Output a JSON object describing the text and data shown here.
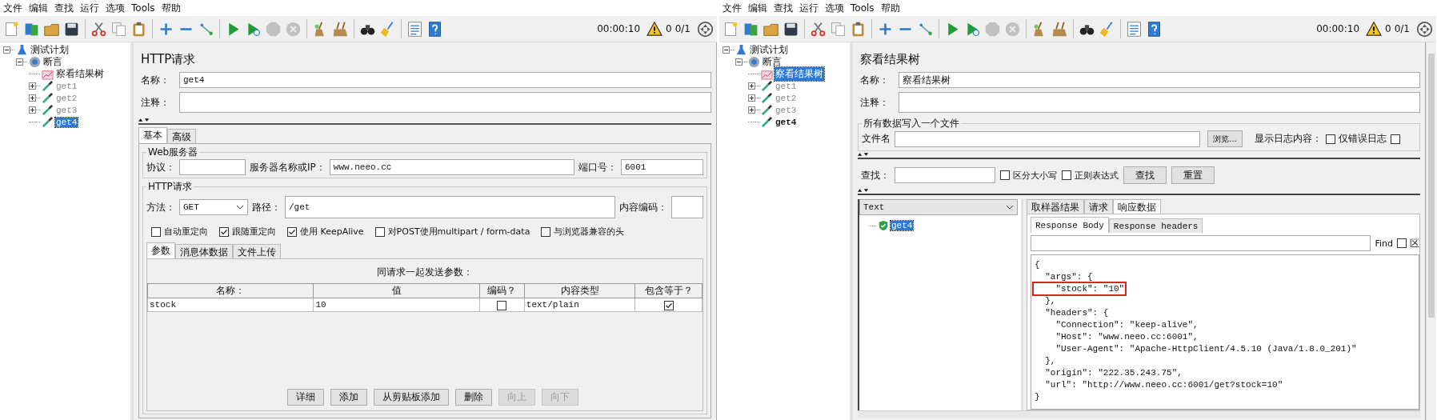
{
  "windows": [
    {
      "kind": "http_request",
      "menu": [
        "文件",
        "编辑",
        "查找",
        "运行",
        "选项",
        "Tools",
        "帮助"
      ],
      "toolbar": [
        {
          "kind": "new",
          "disabled": false
        },
        {
          "kind": "templates",
          "disabled": false
        },
        {
          "kind": "open",
          "disabled": false
        },
        {
          "kind": "save",
          "disabled": false
        },
        {
          "kind": "separator"
        },
        {
          "kind": "cut",
          "disabled": false
        },
        {
          "kind": "copy",
          "disabled": false
        },
        {
          "kind": "paste",
          "disabled": false
        },
        {
          "kind": "separator"
        },
        {
          "kind": "expand",
          "disabled": false
        },
        {
          "kind": "collapse",
          "disabled": false
        },
        {
          "kind": "toggle",
          "disabled": false
        },
        {
          "kind": "separator"
        },
        {
          "kind": "start",
          "disabled": false
        },
        {
          "kind": "start_no_pause",
          "disabled": false
        },
        {
          "kind": "stop",
          "disabled": true
        },
        {
          "kind": "shutdown",
          "disabled": true
        },
        {
          "kind": "separator"
        },
        {
          "kind": "clear",
          "disabled": false
        },
        {
          "kind": "clear_all",
          "disabled": false
        },
        {
          "kind": "separator"
        },
        {
          "kind": "search",
          "disabled": false
        },
        {
          "kind": "reset",
          "disabled": false
        },
        {
          "kind": "separator"
        },
        {
          "kind": "function_helper",
          "disabled": false
        },
        {
          "kind": "help",
          "disabled": false
        }
      ],
      "status": {
        "timer": "00:00:10",
        "warnings": "0",
        "threads": "0/1"
      },
      "tree": [
        {
          "label": "测试计划",
          "kind": "test_plan",
          "expanded": true,
          "selected": false,
          "children": [
            {
              "label": "断言",
              "kind": "assertion",
              "expanded": true,
              "selected": false,
              "children": [
                {
                  "label": "察看结果树",
                  "kind": "listener",
                  "selected": false,
                  "disabled": false,
                  "bold": false
                },
                {
                  "label": "get1",
                  "kind": "sampler",
                  "expanded": false,
                  "selected": false,
                  "disabled": true,
                  "bold": false
                },
                {
                  "label": "get2",
                  "kind": "sampler",
                  "expanded": false,
                  "selected": false,
                  "disabled": true,
                  "bold": false
                },
                {
                  "label": "get3",
                  "kind": "sampler",
                  "expanded": false,
                  "selected": false,
                  "disabled": true,
                  "bold": false
                },
                {
                  "label": "get4",
                  "kind": "sampler",
                  "selected": true,
                  "disabled": false,
                  "bold": false
                }
              ]
            }
          ]
        }
      ],
      "panel": {
        "title": "HTTP请求",
        "name_label": "名称：",
        "name_value": "get4",
        "comment_label": "注释：",
        "tabs": [
          {
            "label": "基本",
            "selected": true
          },
          {
            "label": "高级",
            "selected": false
          }
        ],
        "web_server": {
          "legend": "Web服务器",
          "protocol_label": "协议：",
          "server_label": "服务器名称或IP：",
          "server_value": "www.neeo.cc",
          "port_label": "端口号：",
          "port_value": "6001"
        },
        "http": {
          "legend": "HTTP请求",
          "method_label": "方法：",
          "method_value": "GET",
          "path_label": "路径：",
          "path_value": "/get",
          "encoding_label": "内容编码："
        },
        "options": [
          {
            "label": "自动重定向",
            "checked": false
          },
          {
            "label": "跟随重定向",
            "checked": true
          },
          {
            "label": "使用 KeepAlive",
            "checked": true
          },
          {
            "label": "对POST使用multipart / form-data",
            "checked": false
          },
          {
            "label": "与浏览器兼容的头",
            "checked": false
          }
        ],
        "sub_tabs": [
          {
            "label": "参数",
            "selected": true
          },
          {
            "label": "消息体数据",
            "selected": false
          },
          {
            "label": "文件上传",
            "selected": false
          }
        ],
        "params_caption": "同请求一起发送参数：",
        "columns": [
          "名称：",
          "值",
          "编码？",
          "内容类型",
          "包含等于？"
        ],
        "rows": [
          {
            "name": "stock",
            "value": "10",
            "encode": false,
            "content_type": "text/plain",
            "include_equals": true
          }
        ],
        "buttons": [
          {
            "label": "详细",
            "disabled": false
          },
          {
            "label": "添加",
            "disabled": false
          },
          {
            "label": "从剪贴板添加",
            "disabled": false
          },
          {
            "label": "删除",
            "disabled": false
          },
          {
            "label": "向上",
            "disabled": true
          },
          {
            "label": "向下",
            "disabled": true
          }
        ]
      }
    },
    {
      "kind": "results_tree",
      "menu": [
        "文件",
        "编辑",
        "查找",
        "运行",
        "选项",
        "Tools",
        "帮助"
      ],
      "toolbar": [
        {
          "kind": "new",
          "disabled": false
        },
        {
          "kind": "templates",
          "disabled": false
        },
        {
          "kind": "open",
          "disabled": false
        },
        {
          "kind": "save",
          "disabled": false
        },
        {
          "kind": "separator"
        },
        {
          "kind": "cut",
          "disabled": false
        },
        {
          "kind": "copy",
          "disabled": false
        },
        {
          "kind": "paste",
          "disabled": false
        },
        {
          "kind": "separator"
        },
        {
          "kind": "expand",
          "disabled": false
        },
        {
          "kind": "collapse",
          "disabled": false
        },
        {
          "kind": "toggle",
          "disabled": false
        },
        {
          "kind": "separator"
        },
        {
          "kind": "start",
          "disabled": false
        },
        {
          "kind": "start_no_pause",
          "disabled": false
        },
        {
          "kind": "stop",
          "disabled": true
        },
        {
          "kind": "shutdown",
          "disabled": true
        },
        {
          "kind": "separator"
        },
        {
          "kind": "clear",
          "disabled": false
        },
        {
          "kind": "clear_all",
          "disabled": false
        },
        {
          "kind": "separator"
        },
        {
          "kind": "search",
          "disabled": false
        },
        {
          "kind": "reset",
          "disabled": false
        },
        {
          "kind": "separator"
        },
        {
          "kind": "function_helper",
          "disabled": false
        },
        {
          "kind": "help",
          "disabled": false
        }
      ],
      "status": {
        "timer": "00:00:10",
        "warnings": "0",
        "threads": "0/1"
      },
      "tree": [
        {
          "label": "测试计划",
          "kind": "test_plan",
          "expanded": true,
          "selected": false,
          "children": [
            {
              "label": "断言",
              "kind": "assertion",
              "expanded": true,
              "selected": false,
              "children": [
                {
                  "label": "察看结果树",
                  "kind": "listener",
                  "selected": true,
                  "disabled": false,
                  "bold": false
                },
                {
                  "label": "get1",
                  "kind": "sampler",
                  "expanded": false,
                  "selected": false,
                  "disabled": true,
                  "bold": false
                },
                {
                  "label": "get2",
                  "kind": "sampler",
                  "expanded": false,
                  "selected": false,
                  "disabled": true,
                  "bold": false
                },
                {
                  "label": "get3",
                  "kind": "sampler",
                  "expanded": false,
                  "selected": false,
                  "disabled": true,
                  "bold": false
                },
                {
                  "label": "get4",
                  "kind": "sampler",
                  "selected": false,
                  "disabled": false,
                  "bold": true
                }
              ]
            }
          ]
        }
      ],
      "panel": {
        "title": "察看结果树",
        "name_label": "名称：",
        "name_value": "察看结果树",
        "comment_label": "注释：",
        "file_section": {
          "legend": "所有数据写入一个文件",
          "file_label": "文件名",
          "browse_button": "浏览...",
          "log_label": "显示日志内容：",
          "options": [
            {
              "label": "仅错误日志",
              "checked": false
            },
            {
              "checked": false
            }
          ]
        },
        "search": {
          "label": "查找：",
          "options": [
            {
              "label": "区分大小写",
              "checked": false
            },
            {
              "label": "正则表达式",
              "checked": false
            }
          ],
          "buttons": [
            "查找",
            "重置"
          ]
        },
        "renderer": "Text",
        "results": [
          {
            "label": "get4",
            "selected": true
          }
        ],
        "result_tabs": [
          {
            "label": "取样器结果",
            "selected": false
          },
          {
            "label": "请求",
            "selected": false
          },
          {
            "label": "响应数据",
            "selected": true
          }
        ],
        "body_tabs": [
          {
            "label": "Response Body",
            "selected": true
          },
          {
            "label": "Response headers",
            "selected": false
          }
        ],
        "find_label": "Find",
        "find_option": {
          "label": "区",
          "checked": false
        },
        "response_lines": [
          {
            "text": "{",
            "highlighted": false
          },
          {
            "text": "  \"args\": {",
            "highlighted": false
          },
          {
            "text": "    \"stock\": \"10\"",
            "highlighted": true
          },
          {
            "text": "  },",
            "highlighted": false
          },
          {
            "text": "  \"headers\": {",
            "highlighted": false
          },
          {
            "text": "    \"Connection\": \"keep-alive\",",
            "highlighted": false
          },
          {
            "text": "    \"Host\": \"www.neeo.cc:6001\",",
            "highlighted": false
          },
          {
            "text": "    \"User-Agent\": \"Apache-HttpClient/4.5.10 (Java/1.8.0_201)\"",
            "highlighted": false
          },
          {
            "text": "  },",
            "highlighted": false
          },
          {
            "text": "  \"origin\": \"222.35.243.75\",",
            "highlighted": false
          },
          {
            "text": "  \"url\": \"http://www.neeo.cc:6001/get?stock=10\"",
            "highlighted": false
          },
          {
            "text": "}",
            "highlighted": false
          }
        ]
      }
    }
  ]
}
